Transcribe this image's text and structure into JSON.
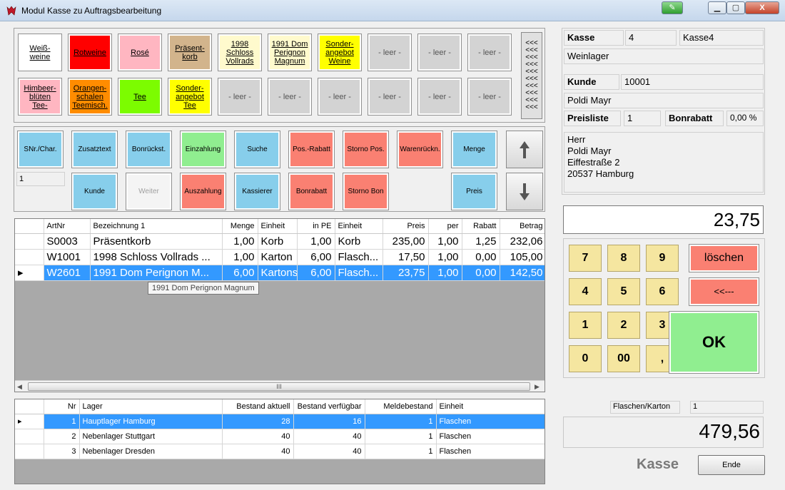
{
  "window": {
    "title": "Modul Kasse zu Auftragsbearbeitung",
    "min": "▁",
    "max": "▢",
    "close": "X"
  },
  "quickbuttons": {
    "row1": [
      {
        "label": "Weiß-weine",
        "color": "#ffffff"
      },
      {
        "label": "Rotweine",
        "color": "#ff0000"
      },
      {
        "label": "Rosé",
        "color": "#ffb6c1"
      },
      {
        "label": "Präsent-korb",
        "color": "#d2b48c"
      },
      {
        "label": "1998 Schloss Vollrads",
        "color": "#fffacd"
      },
      {
        "label": "1991 Dom Perignon Magnum",
        "color": "#fffacd"
      },
      {
        "label": "Sonder-angebot Weine",
        "color": "#ffff00"
      },
      {
        "label": "- leer -",
        "color": "#d3d3d3"
      },
      {
        "label": "- leer -",
        "color": "#d3d3d3"
      },
      {
        "label": "- leer -",
        "color": "#d3d3d3"
      }
    ],
    "row2": [
      {
        "label": "Himbeer-blüten Tee-",
        "color": "#ffb6c1"
      },
      {
        "label": "Orangen-schalen Teemisch.",
        "color": "#ff8c00"
      },
      {
        "label": "Tee",
        "color": "#7cfc00"
      },
      {
        "label": "Sonder-angebot Tee",
        "color": "#ffff00"
      },
      {
        "label": "- leer -",
        "color": "#d3d3d3"
      },
      {
        "label": "- leer -",
        "color": "#d3d3d3"
      },
      {
        "label": "- leer -",
        "color": "#d3d3d3"
      },
      {
        "label": "- leer -",
        "color": "#d3d3d3"
      },
      {
        "label": "- leer -",
        "color": "#d3d3d3"
      },
      {
        "label": "- leer -",
        "color": "#d3d3d3"
      }
    ],
    "scroll": "<<<"
  },
  "functions": {
    "snr": "SNr./Char.",
    "zusatztext": "Zusatztext",
    "bonrueckst": "Bonrückst.",
    "einzahlung": "Einzahlung",
    "suche": "Suche",
    "posrabatt": "Pos.-Rabatt",
    "stornopos": "Storno Pos.",
    "warenrueckn": "Warenrückn.",
    "menge": "Menge",
    "kunde": "Kunde",
    "weiter": "Weiter",
    "auszahlung": "Auszahlung",
    "kassierer": "Kassierer",
    "bonrabatt": "Bonrabatt",
    "stornobon": "Storno Bon",
    "preis": "Preis",
    "qty_value": "1"
  },
  "positions": {
    "headers": [
      "ArtNr",
      "Bezeichnung 1",
      "Menge",
      "Einheit",
      "in PE",
      "Einheit",
      "Preis",
      "per",
      "Rabatt",
      "Betrag"
    ],
    "rows": [
      [
        "S0003",
        "Präsentkorb",
        "1,00",
        "Korb",
        "1,00",
        "Korb",
        "235,00",
        "1,00",
        "1,25",
        "232,06"
      ],
      [
        "W1001",
        "1998 Schloss Vollrads ...",
        "1,00",
        "Karton",
        "6,00",
        "Flasch...",
        "17,50",
        "1,00",
        "0,00",
        "105,00"
      ],
      [
        "W2601",
        "1991 Dom Perignon M...",
        "6,00",
        "Kartons",
        "6,00",
        "Flasch...",
        "23,75",
        "1,00",
        "0,00",
        "142,50"
      ]
    ],
    "tooltip": "1991 Dom Perignon Magnum",
    "scroll_thumb": "III"
  },
  "lager": {
    "headers": [
      "Nr",
      "Lager",
      "Bestand aktuell",
      "Bestand verfügbar",
      "Meldebestand",
      "Einheit"
    ],
    "rows": [
      [
        "1",
        "Hauptlager Hamburg",
        "28",
        "16",
        "1",
        "Flaschen"
      ],
      [
        "2",
        "Nebenlager Stuttgart",
        "40",
        "40",
        "1",
        "Flaschen"
      ],
      [
        "3",
        "Nebenlager Dresden",
        "40",
        "40",
        "1",
        "Flaschen"
      ]
    ]
  },
  "right": {
    "kasse_label": "Kasse",
    "kasse_nr": "4",
    "kasse_name": "Kasse4",
    "lager": "Weinlager",
    "kunde_label": "Kunde",
    "kunde_nr": "10001",
    "kunde_name": "Poldi Mayr",
    "preisliste_label": "Preisliste",
    "preisliste": "1",
    "bonrabatt_label": "Bonrabatt",
    "bonrabatt": "0,00 %",
    "address": [
      "Herr",
      "Poldi Mayr",
      "Eiffestraße 2",
      "20537 Hamburg"
    ],
    "display": "23,75",
    "flaschen_label": "Flaschen/Karton",
    "flaschen_value": "1",
    "total": "479,56",
    "mode": "Kasse",
    "ende": "Ende"
  },
  "numpad": {
    "keys": [
      "7",
      "8",
      "9",
      "4",
      "5",
      "6",
      "1",
      "2",
      "3",
      "0",
      "00",
      ","
    ],
    "loeschen": "löschen",
    "back": "<<---",
    "ok": "OK"
  }
}
